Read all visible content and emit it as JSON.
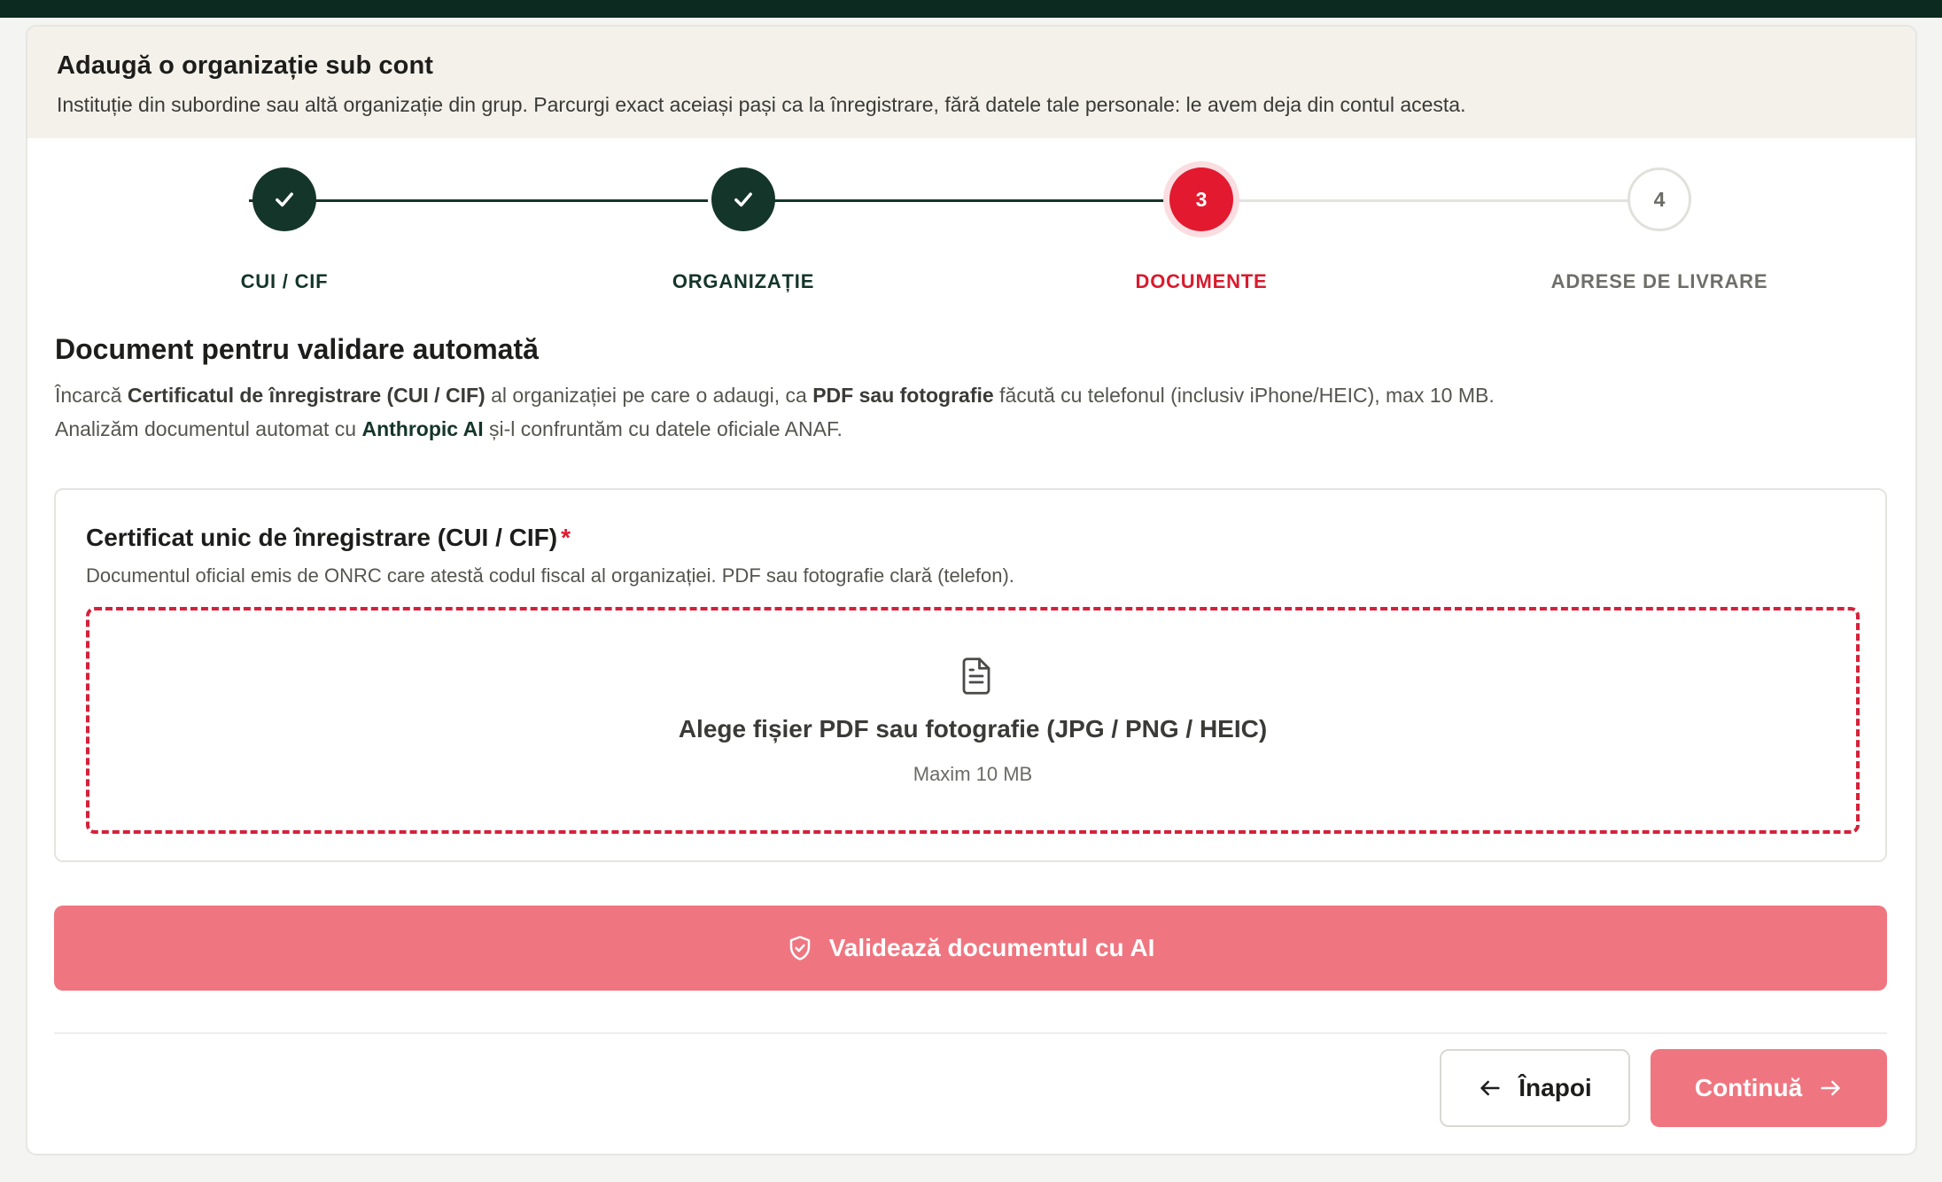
{
  "header": {
    "title": "Adaugă o organizație sub cont",
    "subtitle": "Instituție din subordine sau altă organizație din grup. Parcurgi exact aceiași pași ca la înregistrare, fără datele tale personale: le avem deja din contul acesta."
  },
  "stepper": {
    "steps": [
      {
        "number": "1",
        "label": "CUI / CIF",
        "state": "completed"
      },
      {
        "number": "2",
        "label": "ORGANIZAȚIE",
        "state": "completed"
      },
      {
        "number": "3",
        "label": "DOCUMENTE",
        "state": "active"
      },
      {
        "number": "4",
        "label": "ADRESE DE LIVRARE",
        "state": "pending"
      }
    ]
  },
  "section": {
    "title": "Document pentru validare automată",
    "line1_pre": "Încarcă ",
    "line1_b1": "Certificatul de înregistrare (CUI / CIF)",
    "line1_mid": " al organizației pe care o adaugi, ca ",
    "line1_b2": "PDF sau fotografie",
    "line1_post": " făcută cu telefonul (inclusiv iPhone/HEIC), max 10 MB.",
    "line2_pre": "Analizăm documentul automat cu ",
    "line2_brand": "Anthropic AI",
    "line2_post": " și-l confruntăm cu datele oficiale ANAF."
  },
  "document": {
    "title": "Certificat unic de înregistrare (CUI / CIF)",
    "required_mark": "*",
    "description": "Documentul oficial emis de ONRC care atestă codul fiscal al organizației. PDF sau fotografie clară (telefon).",
    "dropzone_title": "Alege fișier PDF sau fotografie (JPG / PNG / HEIC)",
    "dropzone_hint": "Maxim 10 MB",
    "dropzone_icon": "file-text-icon"
  },
  "actions": {
    "validate_label": "Validează documentul cu AI",
    "back_label": "Înapoi",
    "next_label": "Continuă"
  },
  "colors": {
    "primary_dark": "#14352a",
    "accent_red": "#e2192f",
    "button_disabled": "#ef7680",
    "header_bg": "#f3f1ea"
  }
}
